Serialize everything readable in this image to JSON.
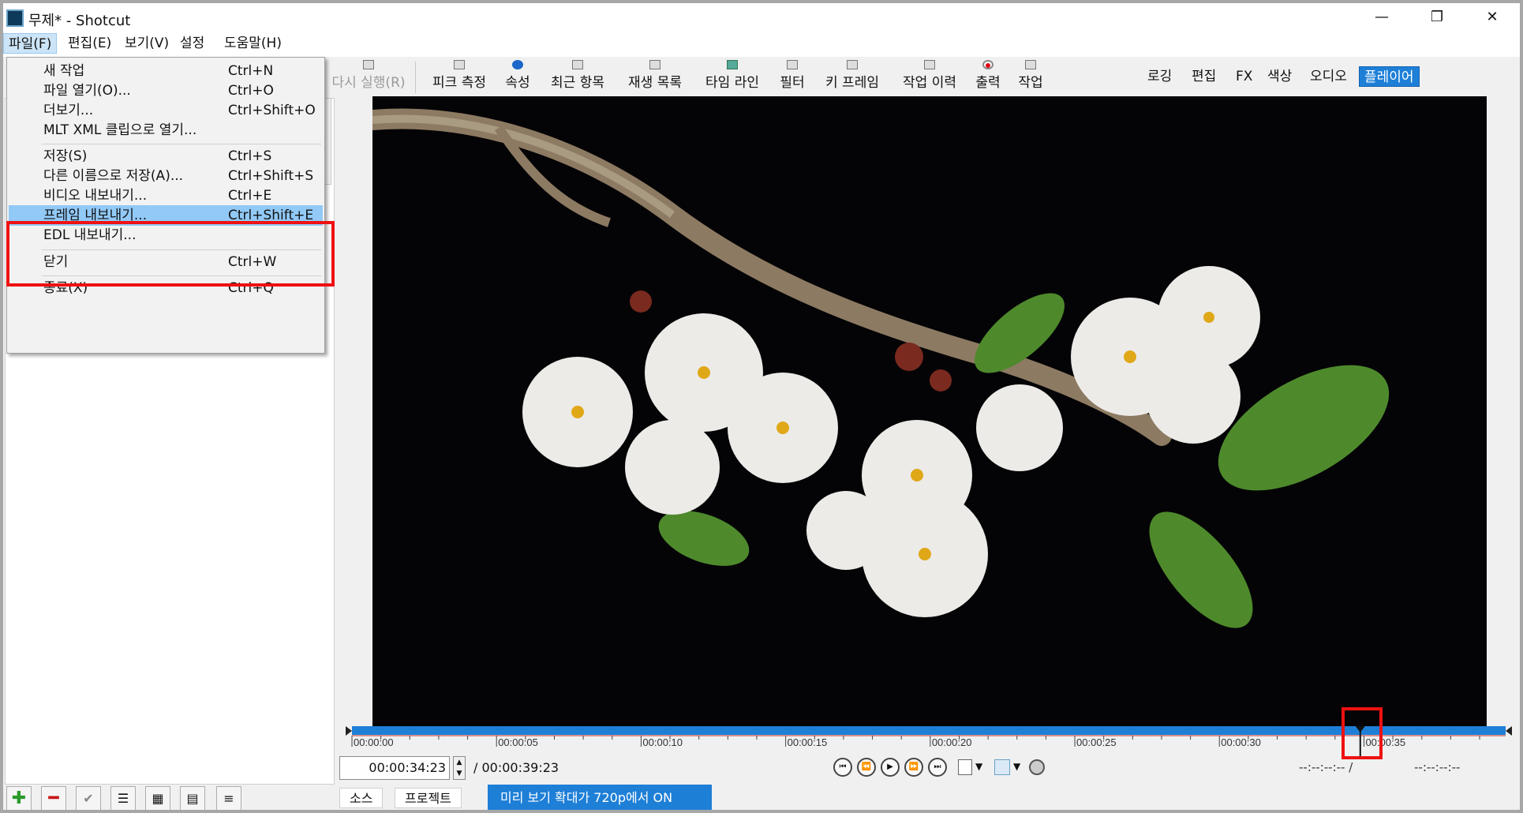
{
  "window": {
    "title": "무제* - Shotcut",
    "controls": {
      "minimize": "—",
      "restore": "❐",
      "close": "✕"
    }
  },
  "menubar": [
    {
      "label": "파일(F)",
      "active": true
    },
    {
      "label": "편집(E)"
    },
    {
      "label": "보기(V)"
    },
    {
      "label": "설정"
    },
    {
      "label": "도움말(H)"
    }
  ],
  "toolbar": {
    "redo": "다시 실행(R)",
    "items": [
      "피크 측정",
      "속성",
      "최근 항목",
      "재생 목록",
      "타임 라인",
      "필터",
      "키 프레임",
      "작업 이력",
      "출력",
      "작업"
    ],
    "layouts": [
      "로깅",
      "편집",
      "FX",
      "색상",
      "오디오",
      "플레이어"
    ],
    "selected_layout": "플레이어"
  },
  "file_menu": {
    "items": [
      {
        "label": "새 작업",
        "shortcut": "Ctrl+N"
      },
      {
        "label": "파일 열기(O)...",
        "shortcut": "Ctrl+O"
      },
      {
        "label": "더보기...",
        "shortcut": "Ctrl+Shift+O"
      },
      {
        "label": "MLT XML 클립으로 열기...",
        "shortcut": ""
      },
      {
        "label": "저장(S)",
        "shortcut": "Ctrl+S"
      },
      {
        "label": "다른 이름으로 저장(A)...",
        "shortcut": "Ctrl+Shift+S"
      },
      {
        "label": "비디오 내보내기...",
        "shortcut": "Ctrl+E"
      },
      {
        "label": "프레임 내보내기...",
        "shortcut": "Ctrl+Shift+E",
        "highlighted": true
      },
      {
        "label": "EDL 내보내기...",
        "shortcut": ""
      },
      {
        "label": "닫기",
        "shortcut": "Ctrl+W"
      },
      {
        "label": "종료(X)",
        "shortcut": "Ctrl+Q"
      }
    ]
  },
  "player": {
    "ruler_labels": [
      "00:00:00",
      "00:00:05",
      "00:00:10",
      "00:00:15",
      "00:00:20",
      "00:00:25",
      "00:00:30",
      "00:00:35"
    ],
    "playhead_fraction": 0.874,
    "current_timecode": "00:00:34:23",
    "duration": "/ 00:00:39:23",
    "in_point": "--:--:--:-- /",
    "out_point": "--:--:--:--"
  },
  "bottom": {
    "tabs": [
      "소스",
      "프로젝트"
    ],
    "banner": "미리 보기 확대가 720p에서 ON"
  },
  "colors": {
    "accent": "#1e7fd7",
    "highlight": "#91c9f7",
    "annotation": "#ee1111"
  }
}
